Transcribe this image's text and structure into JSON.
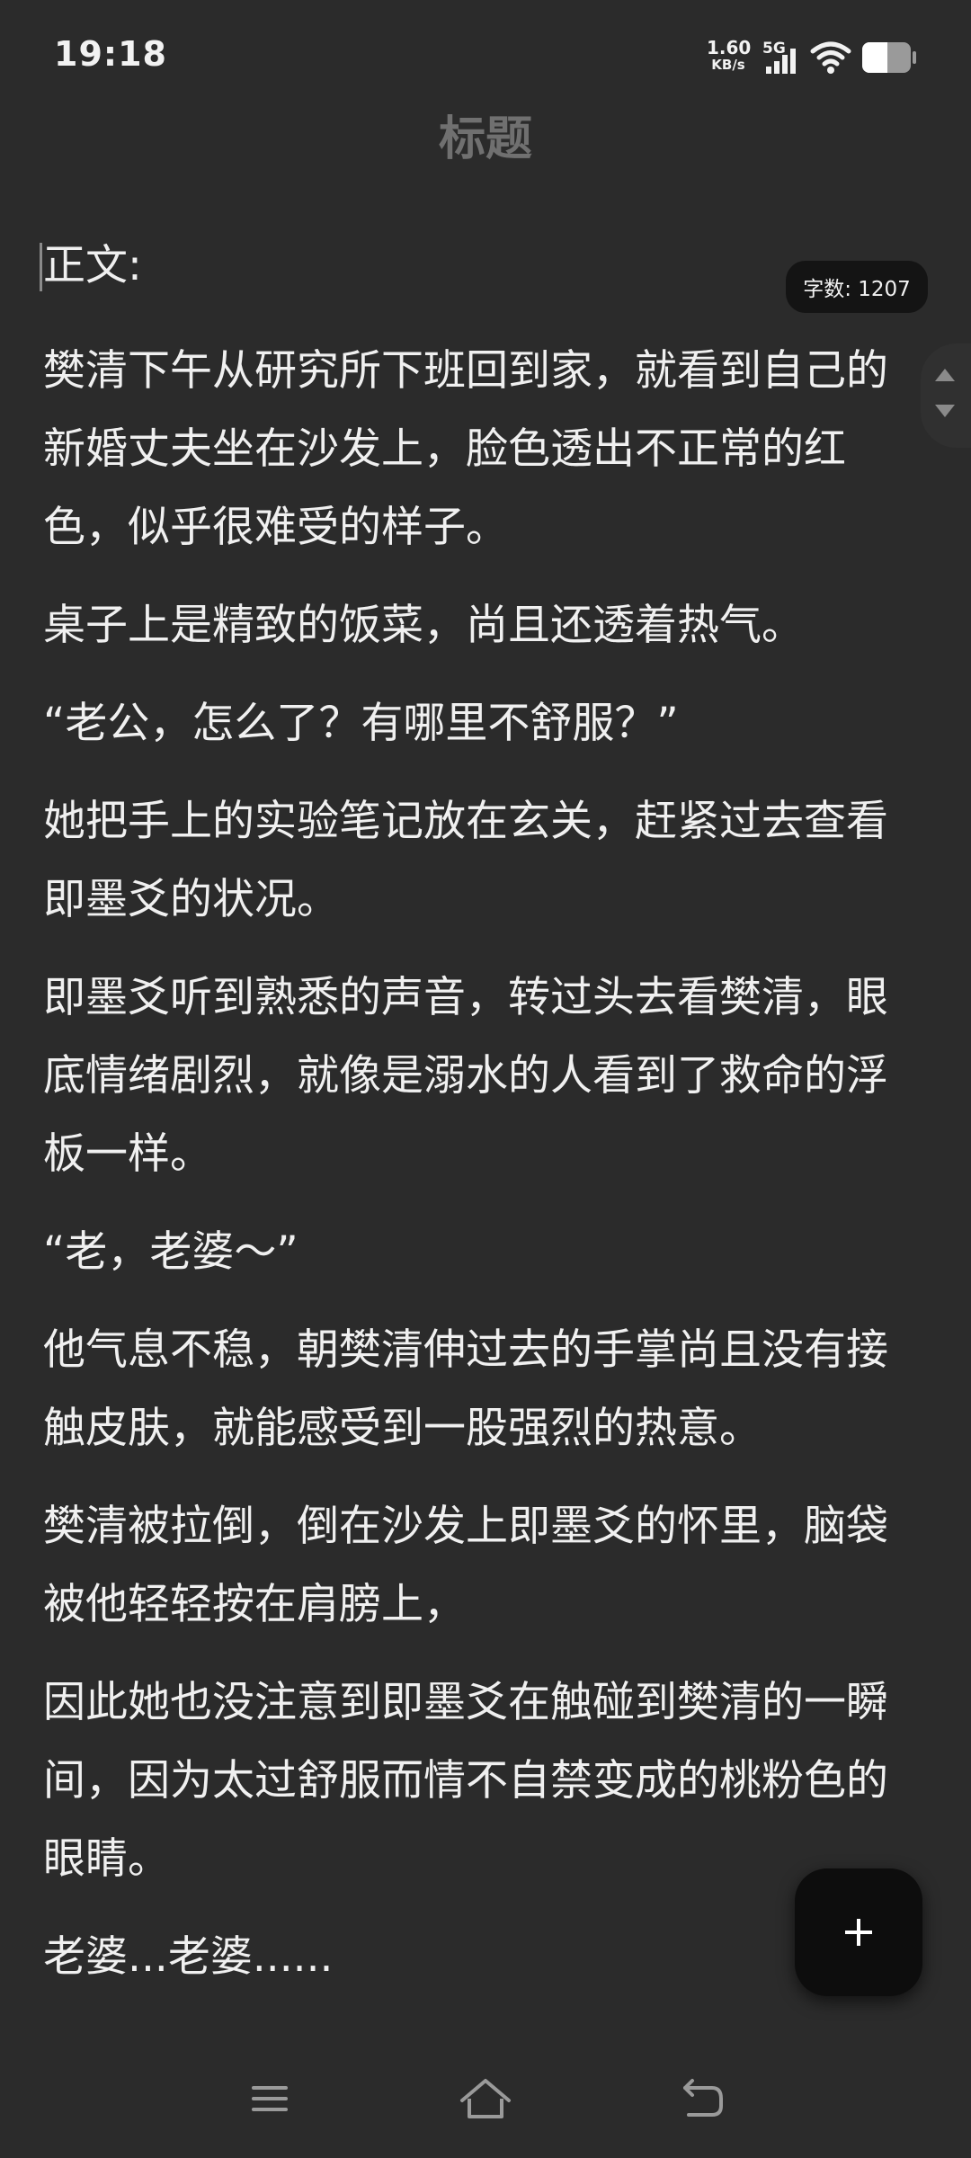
{
  "status_bar": {
    "time": "19:18",
    "network_speed_value": "1.60",
    "network_speed_unit": "KB/s",
    "network_type": "5G",
    "icons": [
      "signal-bars-icon",
      "wifi-icon",
      "battery-icon"
    ]
  },
  "header": {
    "title": "标题"
  },
  "word_count": {
    "label": "字数: 1207"
  },
  "editor": {
    "section_label": "正文:",
    "paragraphs": [
      "樊清下午从研究所下班回到家，就看到自己的新婚丈夫坐在沙发上，脸色透出不正常的红色，似乎很难受的样子。",
      "桌子上是精致的饭菜，尚且还透着热气。",
      "“老公，怎么了？有哪里不舒服？”",
      "她把手上的实验笔记放在玄关，赶紧过去查看即墨爻的状况。",
      "即墨爻听到熟悉的声音，转过头去看樊清，眼底情绪剧烈，就像是溺水的人看到了救命的浮板一样。",
      "“老，老婆～”",
      "他气息不稳，朝樊清伸过去的手掌尚且没有接触皮肤，就能感受到一股强烈的热意。",
      "樊清被拉倒，倒在沙发上即墨爻的怀里，脑袋被他轻轻按在肩膀上，",
      "因此她也没注意到即墨爻在触碰到樊清的一瞬间，因为太过舒服而情不自禁变成的桃粉色的眼睛。",
      "老婆...老婆......"
    ]
  },
  "fab": {
    "icon": "plus-icon"
  },
  "nav_bar": {
    "icons": [
      "menu-icon",
      "home-icon",
      "back-icon"
    ]
  },
  "colors": {
    "background": "#2b2b2b",
    "text": "#f0f0f0",
    "title": "#707070",
    "pill": "#141414",
    "fab": "#0d0d0d"
  }
}
